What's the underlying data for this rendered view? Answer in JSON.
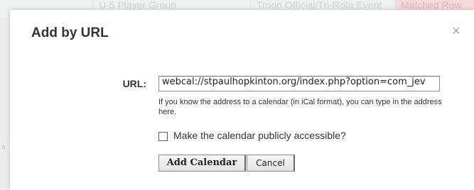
{
  "background": {
    "tab1": "U-5 Player Group",
    "tab2": "Troop Official/Tri-Rota Event",
    "tab3": "Matched Row"
  },
  "dialog": {
    "title": "Add by URL",
    "close_symbol": "×",
    "url_label": "URL:",
    "url_value": "webcal://stpaulhopkinton.org/index.php?option=com_jev",
    "help_text": "If you know the address to a calendar (in iCal format), you can type in the address here.",
    "public_checkbox_label": "Make the calendar publicly accessible?",
    "public_checked": false,
    "add_button": "Add Calendar",
    "cancel_button": "Cancel"
  }
}
